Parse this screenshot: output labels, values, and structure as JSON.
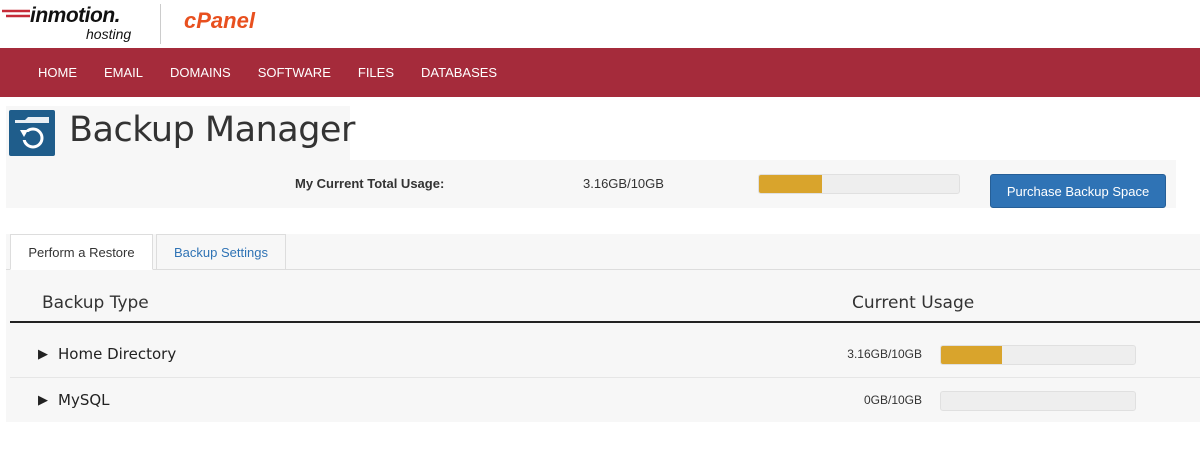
{
  "brand": {
    "company": "inmotion.",
    "company_sub": "hosting",
    "product": "cPanel"
  },
  "nav": {
    "items": [
      "HOME",
      "EMAIL",
      "DOMAINS",
      "SOFTWARE",
      "FILES",
      "DATABASES"
    ]
  },
  "page": {
    "title": "Backup Manager",
    "icon": "backup-restore-icon"
  },
  "usage": {
    "label": "My Current Total Usage:",
    "value": "3.16GB/10GB",
    "percent": 31.6,
    "purchase_label": "Purchase Backup Space"
  },
  "tabs": [
    {
      "label": "Perform a Restore",
      "active": true
    },
    {
      "label": "Backup Settings",
      "active": false
    }
  ],
  "table": {
    "headers": {
      "type": "Backup Type",
      "usage": "Current Usage"
    },
    "rows": [
      {
        "name": "Home Directory",
        "usage": "3.16GB/10GB",
        "percent": 31.6
      },
      {
        "name": "MySQL",
        "usage": "0GB/10GB",
        "percent": 0
      }
    ]
  },
  "colors": {
    "nav_bg": "#a52b3b",
    "accent_blue": "#2f73b5",
    "progress_fill": "#d9a42c",
    "icon_blue": "#1f5d8b",
    "cpanel_orange": "#e8501f"
  }
}
